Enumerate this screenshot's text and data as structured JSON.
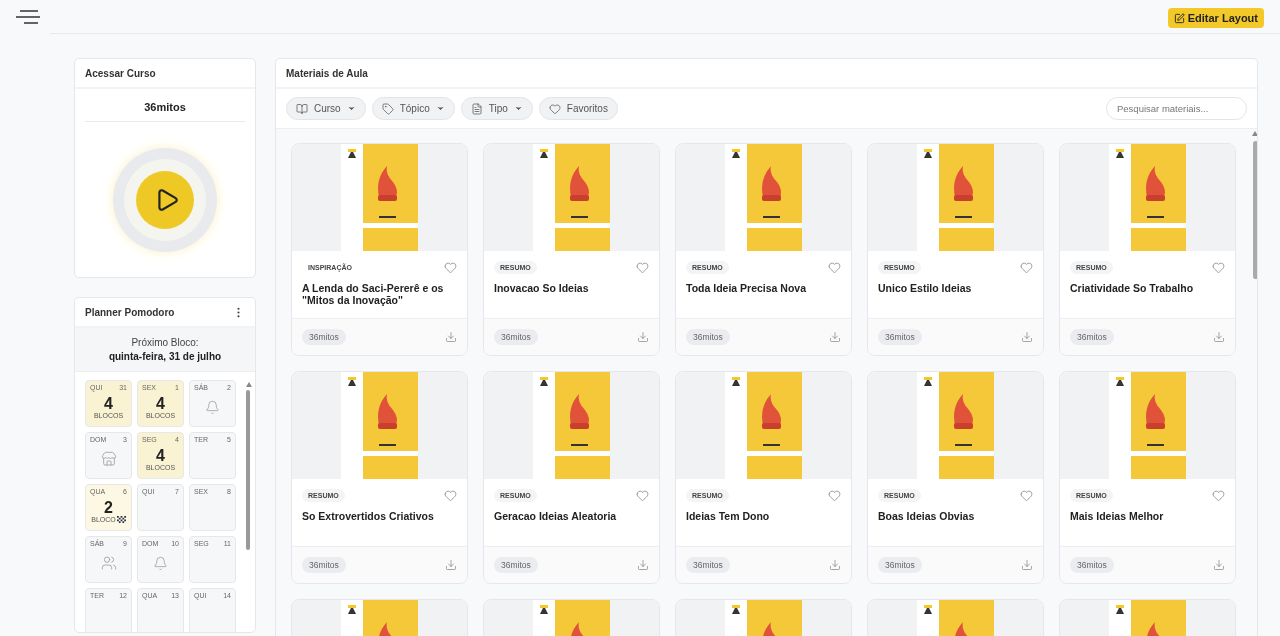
{
  "topbar": {
    "edit_button": "Editar Layout"
  },
  "course_card": {
    "title": "Acessar Curso",
    "course": "36mitos"
  },
  "planner": {
    "title": "Planner Pomodoro",
    "next_label": "Próximo Bloco:",
    "next_date": "quinta-feira, 31 de julho",
    "days": [
      {
        "weekday": "QUI",
        "day": "31",
        "kind": "blocks",
        "count": "4",
        "unit": "BLOCOS",
        "flag": false
      },
      {
        "weekday": "SEX",
        "day": "1",
        "kind": "blocks",
        "count": "4",
        "unit": "BLOCOS",
        "flag": false
      },
      {
        "weekday": "SÁB",
        "day": "2",
        "kind": "bell"
      },
      {
        "weekday": "DOM",
        "day": "3",
        "kind": "store"
      },
      {
        "weekday": "SEG",
        "day": "4",
        "kind": "blocks",
        "count": "4",
        "unit": "BLOCOS",
        "flag": false
      },
      {
        "weekday": "TER",
        "day": "5",
        "kind": "empty"
      },
      {
        "weekday": "QUA",
        "day": "6",
        "kind": "blocks",
        "count": "2",
        "unit": "BLOCO",
        "flag": true
      },
      {
        "weekday": "QUI",
        "day": "7",
        "kind": "empty"
      },
      {
        "weekday": "SEX",
        "day": "8",
        "kind": "empty"
      },
      {
        "weekday": "SÁB",
        "day": "9",
        "kind": "people"
      },
      {
        "weekday": "DOM",
        "day": "10",
        "kind": "bell"
      },
      {
        "weekday": "SEG",
        "day": "11",
        "kind": "empty"
      },
      {
        "weekday": "TER",
        "day": "12",
        "kind": "empty"
      },
      {
        "weekday": "QUA",
        "day": "13",
        "kind": "empty"
      },
      {
        "weekday": "QUI",
        "day": "14",
        "kind": "empty"
      }
    ]
  },
  "materials": {
    "title": "Materiais de Aula",
    "filters": [
      {
        "label": "Curso",
        "kind": "course",
        "dropdown": true
      },
      {
        "label": "Tópico",
        "kind": "topic",
        "dropdown": true
      },
      {
        "label": "Tipo",
        "kind": "type",
        "dropdown": true
      },
      {
        "label": "Favoritos",
        "kind": "favorites",
        "dropdown": false
      }
    ],
    "search": {
      "placeholder": "Pesquisar materiais..."
    },
    "items": [
      {
        "kind": "full",
        "tag": "INSPIRAÇÃO",
        "title": "A Lenda do Saci-Pererê e os \"Mitos da Inovação\"",
        "course": "36mitos",
        "favorite": false
      },
      {
        "kind": "full",
        "tag": "RESUMO",
        "title": "Inovacao So Ideias",
        "course": "36mitos",
        "favorite": false
      },
      {
        "kind": "full",
        "tag": "RESUMO",
        "title": "Toda Ideia Precisa Nova",
        "course": "36mitos",
        "favorite": false
      },
      {
        "kind": "full",
        "tag": "RESUMO",
        "title": "Unico Estilo Ideias",
        "course": "36mitos",
        "favorite": false
      },
      {
        "kind": "full",
        "tag": "RESUMO",
        "title": "Criatividade So Trabalho",
        "course": "36mitos",
        "favorite": false
      },
      {
        "kind": "full",
        "tag": "RESUMO",
        "title": "So Extrovertidos Criativos",
        "course": "36mitos",
        "favorite": false
      },
      {
        "kind": "full",
        "tag": "RESUMO",
        "title": "Geracao Ideias Aleatoria",
        "course": "36mitos",
        "favorite": false
      },
      {
        "kind": "full",
        "tag": "RESUMO",
        "title": "Ideias Tem Dono",
        "course": "36mitos",
        "favorite": false
      },
      {
        "kind": "full",
        "tag": "RESUMO",
        "title": "Boas Ideias Obvias",
        "course": "36mitos",
        "favorite": false
      },
      {
        "kind": "full",
        "tag": "RESUMO",
        "title": "Mais Ideias Melhor",
        "course": "36mitos",
        "favorite": false
      },
      {
        "kind": "cover_only"
      },
      {
        "kind": "cover_only"
      },
      {
        "kind": "cover_only"
      },
      {
        "kind": "cover_only"
      },
      {
        "kind": "cover_only"
      }
    ]
  }
}
